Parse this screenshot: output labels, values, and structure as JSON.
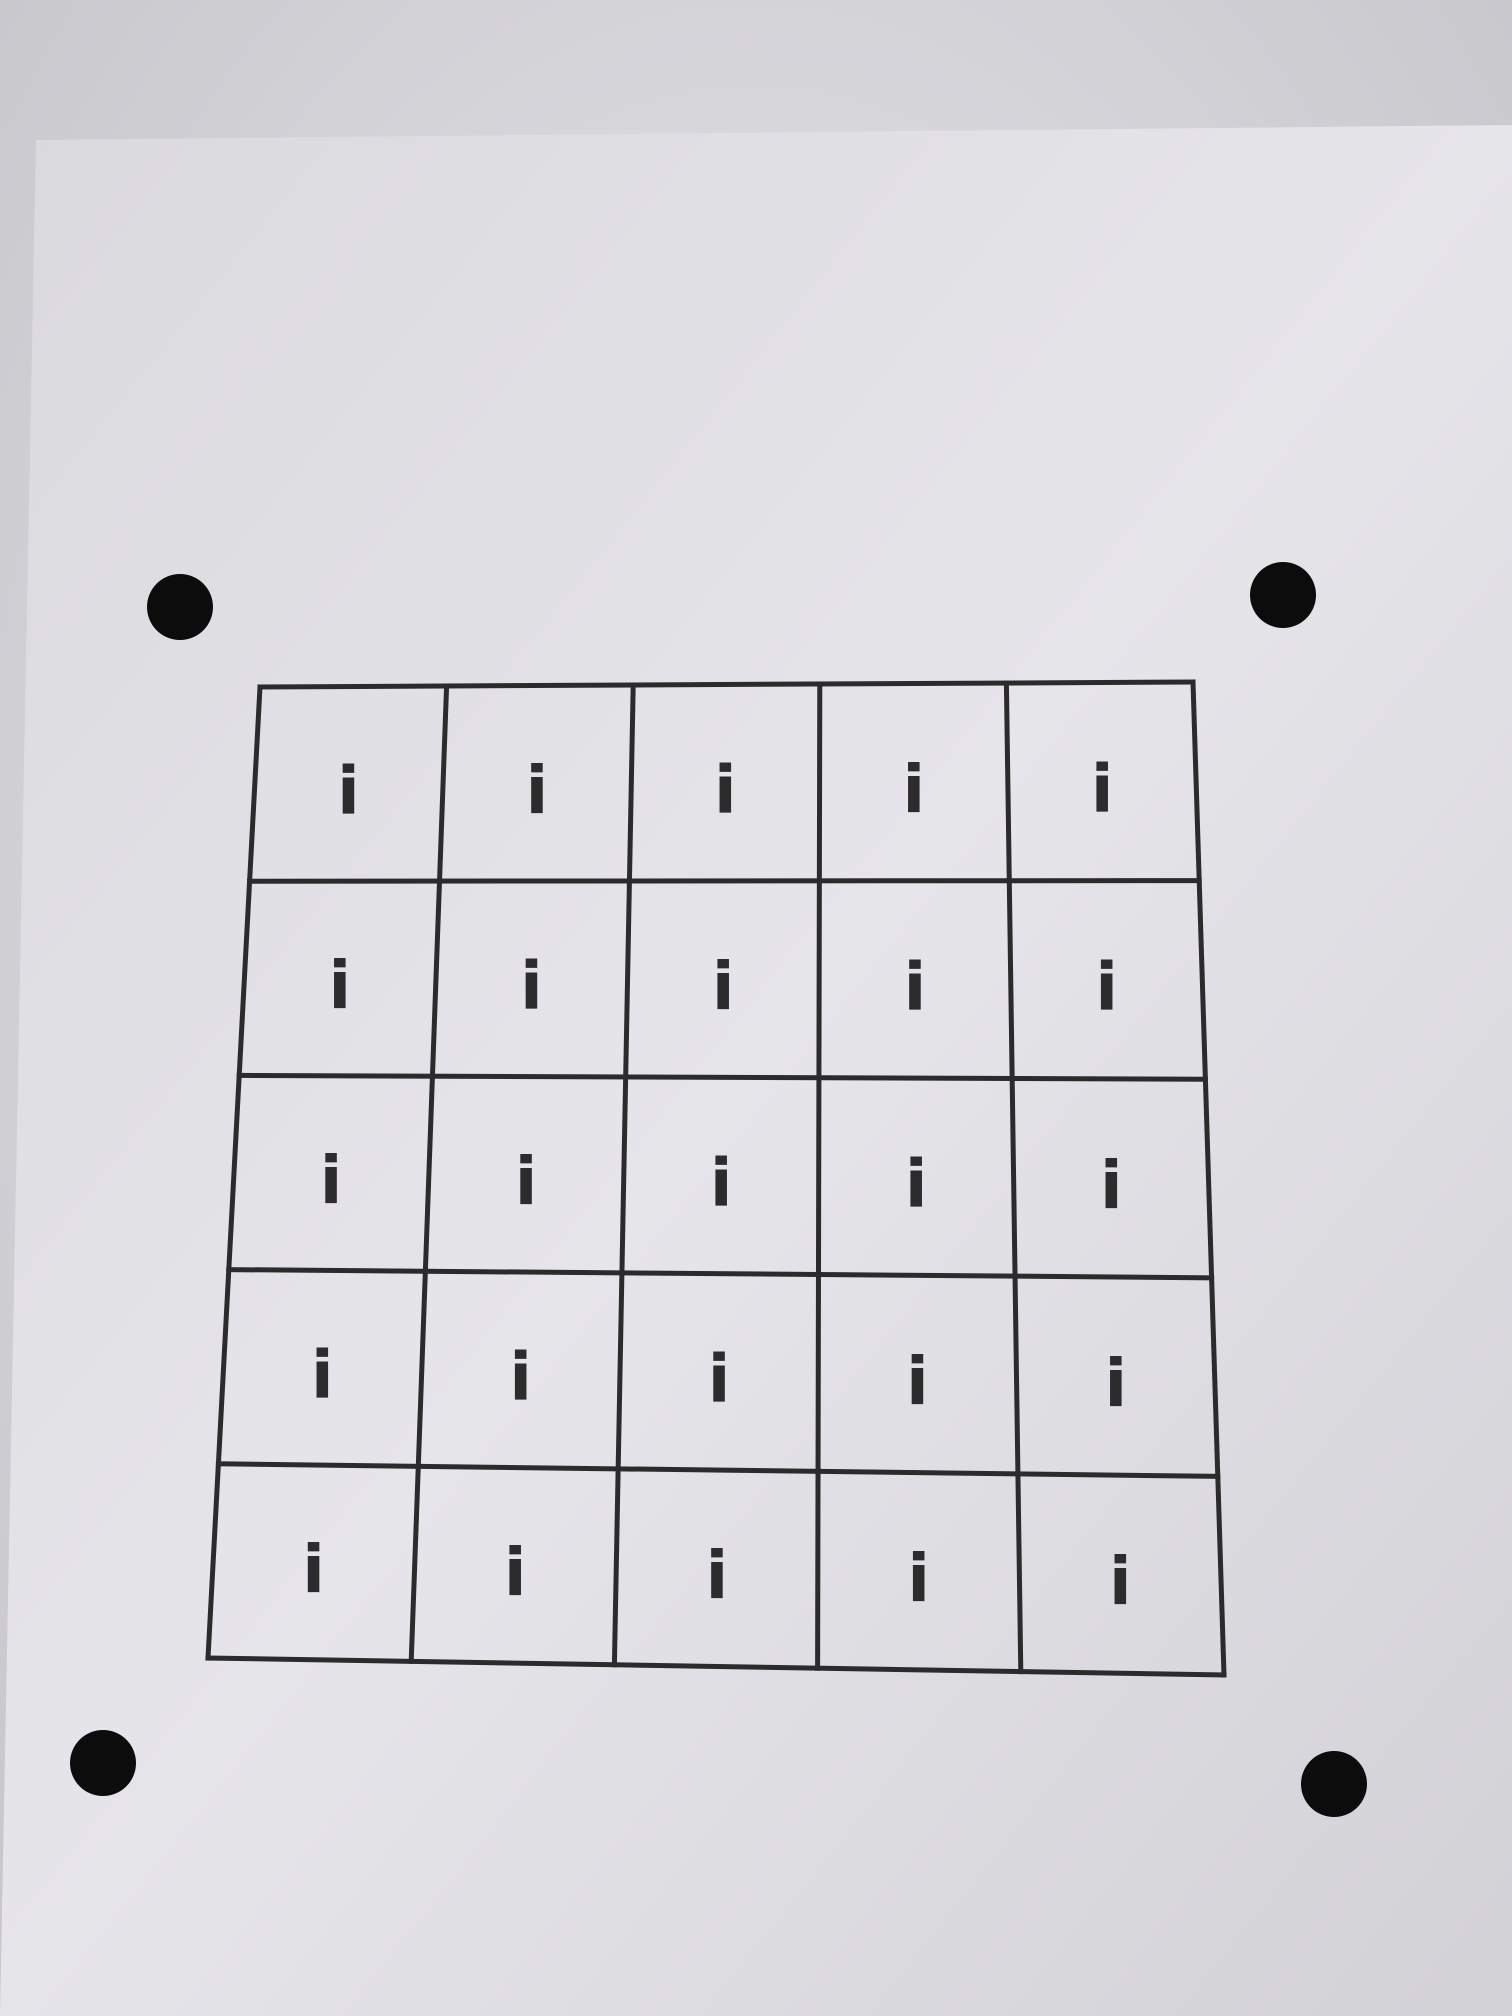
{
  "grid": {
    "rows": 5,
    "cols": 5,
    "cells": [
      [
        "i",
        "i",
        "i",
        "i",
        "i"
      ],
      [
        "i",
        "i",
        "i",
        "i",
        "i"
      ],
      [
        "i",
        "i",
        "i",
        "i",
        "i"
      ],
      [
        "i",
        "i",
        "i",
        "i",
        "i"
      ],
      [
        "i",
        "i",
        "i",
        "i",
        "i"
      ]
    ]
  },
  "registration_marks": 4,
  "colors": {
    "paper": "#e2e1e6",
    "background": "#c9c8cc",
    "ink": "#2b2b2b",
    "dot": "#0c0c0c"
  }
}
